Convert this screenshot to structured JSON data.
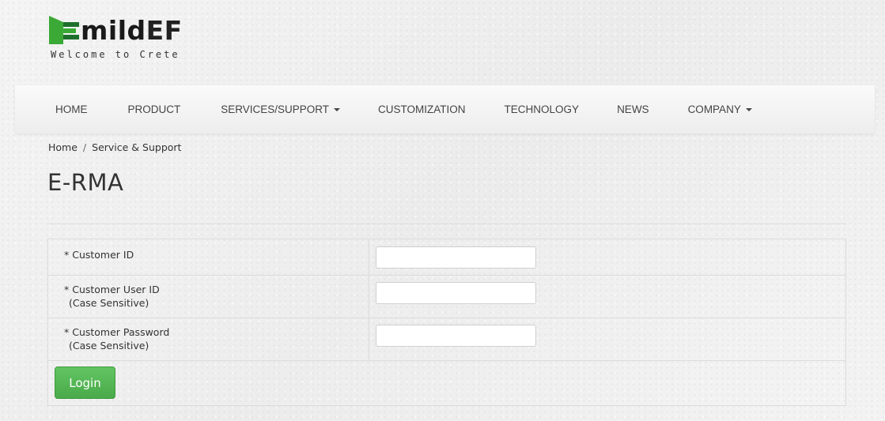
{
  "brand": {
    "logo_text_mild": "mild",
    "logo_text_ef": "EF",
    "tagline": "Welcome to Crete",
    "logo_green": "#3aa935",
    "logo_dark_green": "#1e6f2c"
  },
  "nav": {
    "items": [
      {
        "label": "HOME",
        "has_caret": false
      },
      {
        "label": "PRODUCT",
        "has_caret": false
      },
      {
        "label": "SERVICES/SUPPORT",
        "has_caret": true
      },
      {
        "label": "CUSTOMIZATION",
        "has_caret": false
      },
      {
        "label": "TECHNOLOGY",
        "has_caret": false
      },
      {
        "label": "NEWS",
        "has_caret": false
      },
      {
        "label": "COMPANY",
        "has_caret": true
      }
    ]
  },
  "breadcrumb": {
    "home": "Home",
    "separator": "/",
    "current": "Service & Support"
  },
  "page": {
    "title": "E-RMA"
  },
  "form": {
    "fields": [
      {
        "label": "* Customer ID",
        "sub": "",
        "value": "",
        "placeholder": ""
      },
      {
        "label": "* Customer User ID",
        "sub": "(Case Sensitive)",
        "value": "",
        "placeholder": ""
      },
      {
        "label": "* Customer Password",
        "sub": "(Case Sensitive)",
        "value": "",
        "placeholder": ""
      }
    ],
    "login_label": "Login",
    "login_color": "#5cb85c"
  }
}
